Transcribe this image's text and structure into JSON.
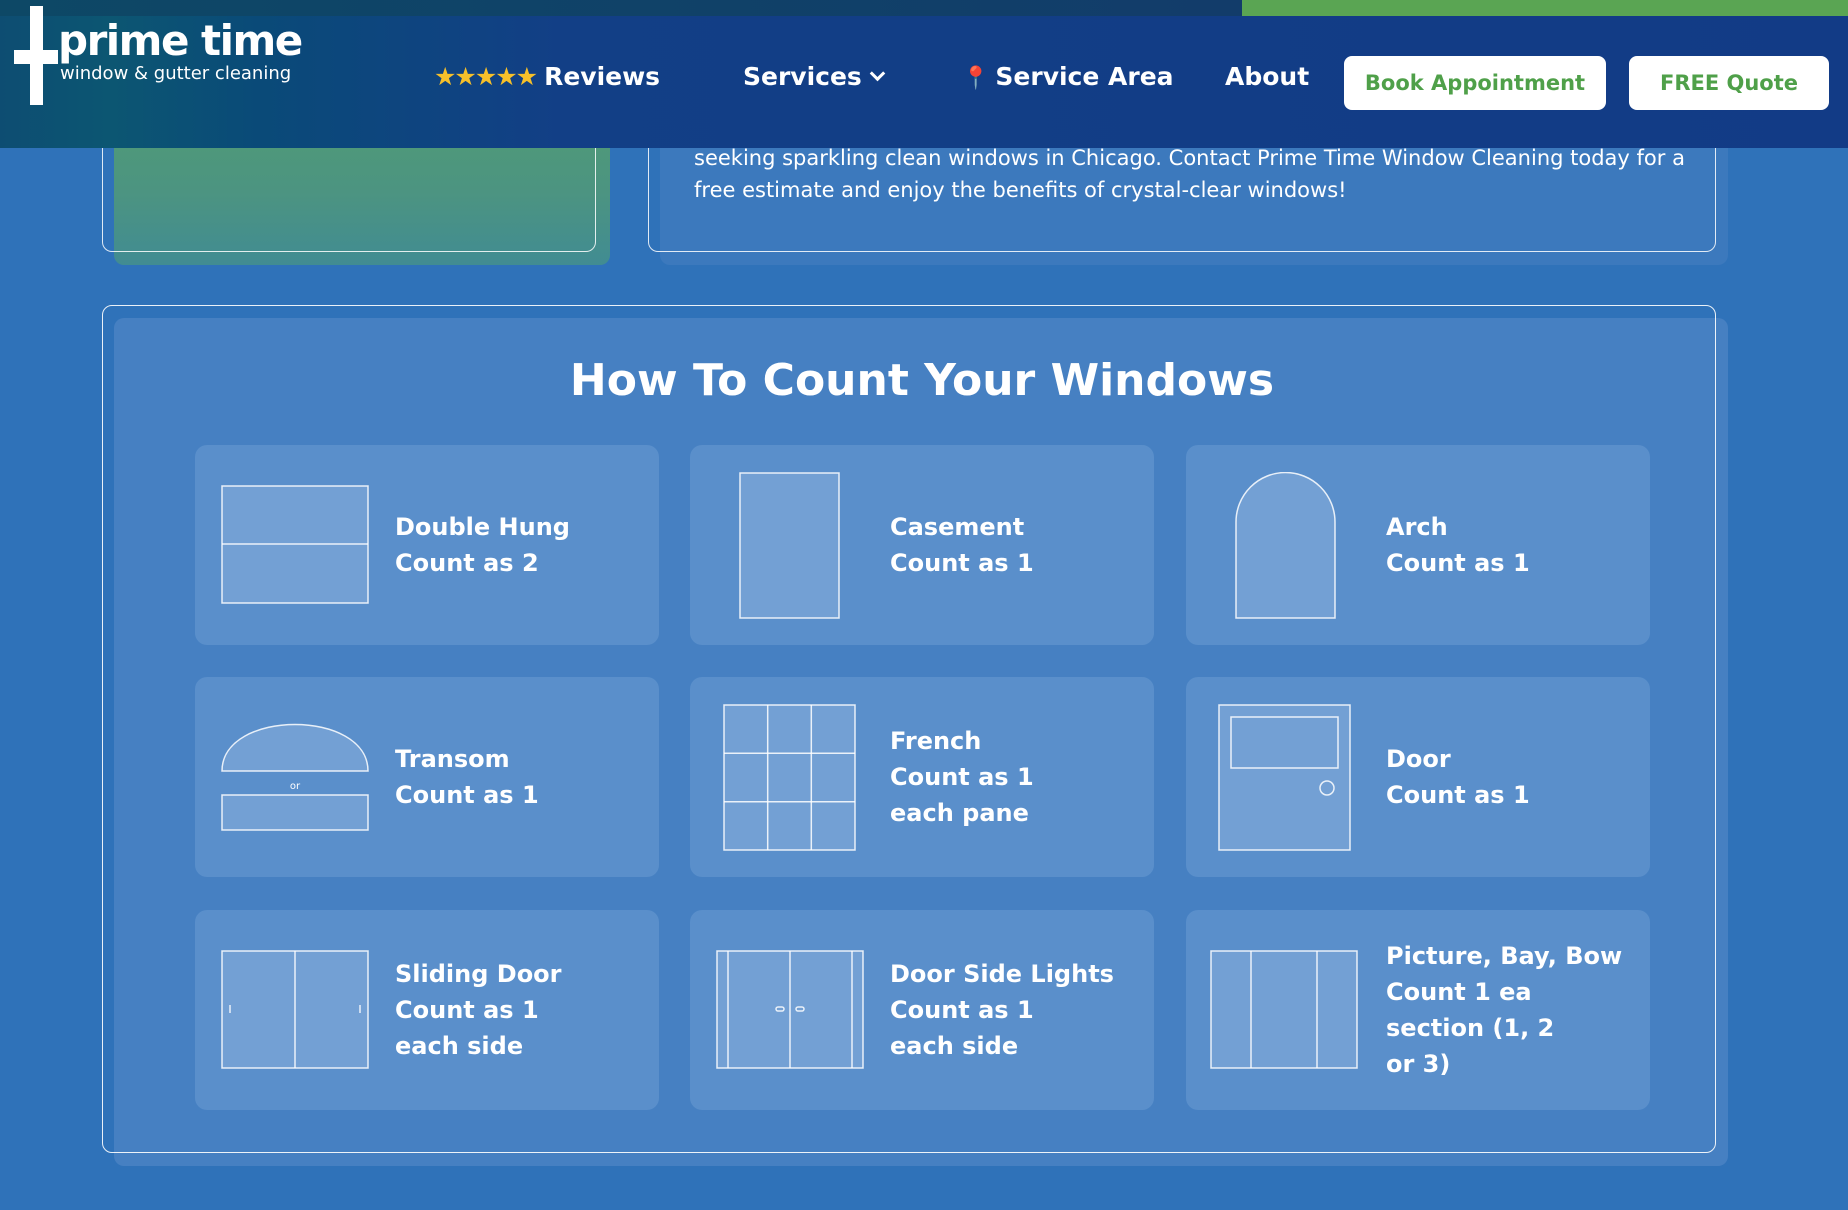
{
  "header": {
    "logo": {
      "name": "prime time",
      "tagline": "window & gutter cleaning"
    },
    "nav": {
      "reviews": {
        "stars": "★★★★★",
        "label": "Reviews"
      },
      "services": {
        "label": "Services"
      },
      "service_area": {
        "pin": "📍",
        "label": "Service Area"
      },
      "about": {
        "label": "About"
      }
    },
    "buttons": {
      "book": "Book Appointment",
      "quote": "FREE Quote"
    }
  },
  "intro": {
    "text": "seeking sparkling clean windows in Chicago. Contact Prime Time Window Cleaning today for a free estimate and enjoy the benefits of crystal-clear windows!"
  },
  "count_section": {
    "title": "How To Count Your Windows",
    "cards": [
      {
        "name": "Double Hung",
        "count": "Count as 2"
      },
      {
        "name": "Casement",
        "count": "Count as 1"
      },
      {
        "name": "Arch",
        "count": "Count as 1"
      },
      {
        "name": "Transom",
        "count": "Count as 1",
        "icon_note": "or"
      },
      {
        "name": "French",
        "count": "Count as 1",
        "extra": "each pane"
      },
      {
        "name": "Door",
        "count": "Count as 1"
      },
      {
        "name": "Sliding Door",
        "count": "Count as 1",
        "extra": "each side"
      },
      {
        "name": "Door Side Lights",
        "count": "Count as 1",
        "extra": "each side"
      },
      {
        "name": "Picture, Bay, Bow",
        "count": "Count 1 ea",
        "extra": "section (1, 2",
        "extra2": "or 3)"
      }
    ]
  },
  "colors": {
    "page_bg": "#2f72b9",
    "header_bg": "#123b86",
    "accent_green": "#4fa049",
    "card_bg": "#5a8fcb",
    "star": "#f6c02a"
  }
}
